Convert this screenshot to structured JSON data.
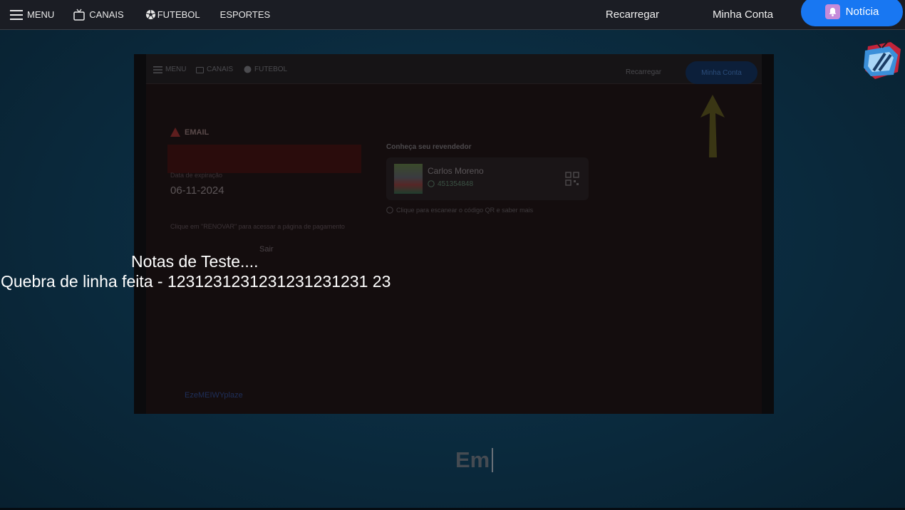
{
  "topbar": {
    "menu_label": "MENU",
    "canais_label": "CANAIS",
    "futebol_label": "FUTEBOL",
    "esportes_label": "ESPORTES",
    "recarregar_label": "Recarregar",
    "minha_conta_label": "Minha Conta",
    "noticia_label": "Notícia",
    "accent_color": "#1877f2"
  },
  "screenshot": {
    "menu_label": "MENU",
    "canais_label": "CANAIS",
    "futebol_label": "FUTEBOL",
    "recarregar_label": "Recarregar",
    "minha_conta_label": "Minha Conta",
    "email_label": "EMAIL",
    "expiration_label": "Data de expiração",
    "expiration_date": "06-11-2024",
    "renovar_hint": "Clique em \"RENOVAR\" para acessar a página de pagamento",
    "sair_label": "Sair",
    "reseller_heading": "Conheça seu revendedor",
    "reseller_name": "Carlos Moreno",
    "reseller_phone": "451354848",
    "scan_hint": "Clique para escanear o código QR e saber mais",
    "footer_text": "EzeMEIWYplaze"
  },
  "notes": {
    "title": "Notas de Teste....",
    "line": "Quebra de linha feita - 1231231231231231231231 23"
  },
  "typing": {
    "text": "Em"
  }
}
